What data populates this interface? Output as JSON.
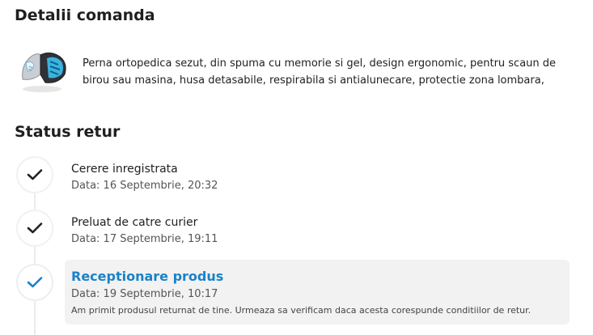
{
  "order": {
    "title": "Detalii comanda",
    "product": {
      "name": "Perna ortopedica sezut, din spuma cu memorie si gel, design ergonomic, pentru scaun de birou sau masina, husa detasabile, respirabila si antialunecare, protectie zona lombara,",
      "image_icon": "seat-cushion-product-image"
    }
  },
  "return_status": {
    "title": "Status retur",
    "accent_color": "#1a82c9",
    "steps": [
      {
        "title": "Cerere inregistrata",
        "date": "Data: 16 Septembrie, 20:32",
        "icon": "check-icon"
      },
      {
        "title": "Preluat de catre curier",
        "date": "Data: 17 Septembrie, 19:11",
        "icon": "check-icon"
      },
      {
        "title": "Receptionare produs",
        "date": "Data: 19 Septembrie, 10:17",
        "note": "Am primit produsul returnat de tine. Urmeaza sa verificam daca acesta corespunde conditiilor de retur.",
        "icon": "check-icon",
        "active": true
      }
    ]
  }
}
